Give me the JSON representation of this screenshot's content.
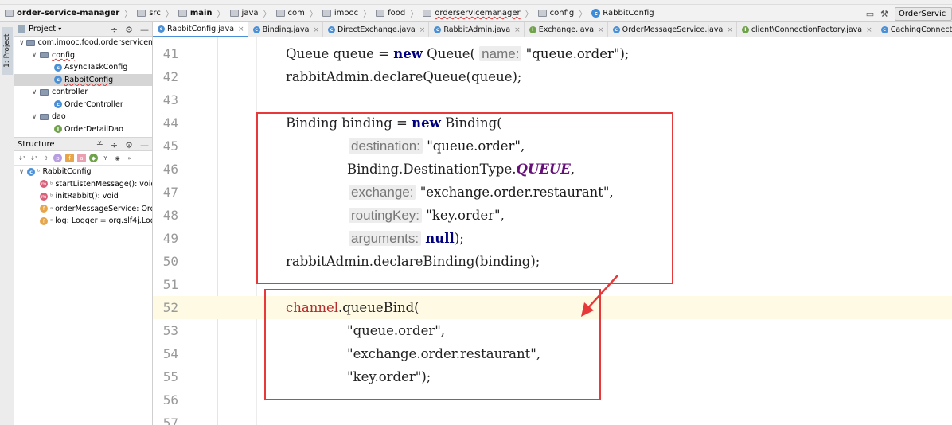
{
  "navbar": {
    "crumbs": [
      {
        "label": "order-service-manager",
        "bold": true
      },
      {
        "label": "src"
      },
      {
        "label": "main",
        "bold": true
      },
      {
        "label": "java"
      },
      {
        "label": "com"
      },
      {
        "label": "imooc"
      },
      {
        "label": "food"
      },
      {
        "label": "orderservicemanager"
      },
      {
        "label": "config"
      },
      {
        "label": "RabbitConfig"
      }
    ],
    "run_config": "OrderServic"
  },
  "toolwindow": {
    "project_tab": "1: Project"
  },
  "project_panel": {
    "title": "Project",
    "tree": [
      {
        "label": "com.imooc.food.orderservicema",
        "type": "package"
      },
      {
        "label": "config",
        "type": "folder"
      },
      {
        "label": "AsyncTaskConfig",
        "type": "class"
      },
      {
        "label": "RabbitConfig",
        "type": "class"
      },
      {
        "label": "controller",
        "type": "folder"
      },
      {
        "label": "OrderController",
        "type": "class"
      },
      {
        "label": "dao",
        "type": "folder"
      },
      {
        "label": "OrderDetailDao",
        "type": "interface"
      }
    ]
  },
  "structure_panel": {
    "title": "Structure",
    "root": "RabbitConfig",
    "members": [
      {
        "label": "startListenMessage(): void",
        "kind": "m"
      },
      {
        "label": "initRabbit(): void",
        "kind": "m"
      },
      {
        "label": "orderMessageService: Ord",
        "kind": "f"
      },
      {
        "label": "log: Logger = org.slf4j.Log",
        "kind": "f"
      }
    ]
  },
  "tabs": [
    {
      "label": "RabbitConfig.java",
      "active": true
    },
    {
      "label": "Binding.java"
    },
    {
      "label": "DirectExchange.java"
    },
    {
      "label": "RabbitAdmin.java"
    },
    {
      "label": "Exchange.java"
    },
    {
      "label": "OrderMessageService.java"
    },
    {
      "label": "client\\ConnectionFactory.java"
    },
    {
      "label": "CachingConnectionFactory.java"
    }
  ],
  "editor": {
    "current_line": 52,
    "lines": [
      {
        "n": "41",
        "text": "Queue queue = new Queue( name: \"queue.order\");"
      },
      {
        "n": "42",
        "text": "rabbitAdmin.declareQueue(queue);"
      },
      {
        "n": "43",
        "text": ""
      },
      {
        "n": "44",
        "text": "Binding binding = new Binding("
      },
      {
        "n": "45",
        "text": "destination: \"queue.order\","
      },
      {
        "n": "46",
        "text": "Binding.DestinationType.QUEUE,"
      },
      {
        "n": "47",
        "text": "exchange: \"exchange.order.restaurant\","
      },
      {
        "n": "48",
        "text": "routingKey: \"key.order\","
      },
      {
        "n": "49",
        "text": "arguments: null);"
      },
      {
        "n": "50",
        "text": "rabbitAdmin.declareBinding(binding);"
      },
      {
        "n": "51",
        "text": ""
      },
      {
        "n": "52",
        "text": "channel.queueBind("
      },
      {
        "n": "53",
        "text": "\"queue.order\","
      },
      {
        "n": "54",
        "text": "\"exchange.order.restaurant\","
      },
      {
        "n": "55",
        "text": "\"key.order\");"
      },
      {
        "n": "56",
        "text": ""
      },
      {
        "n": "57",
        "text": ""
      }
    ]
  },
  "annotation_color": "#e8393a"
}
